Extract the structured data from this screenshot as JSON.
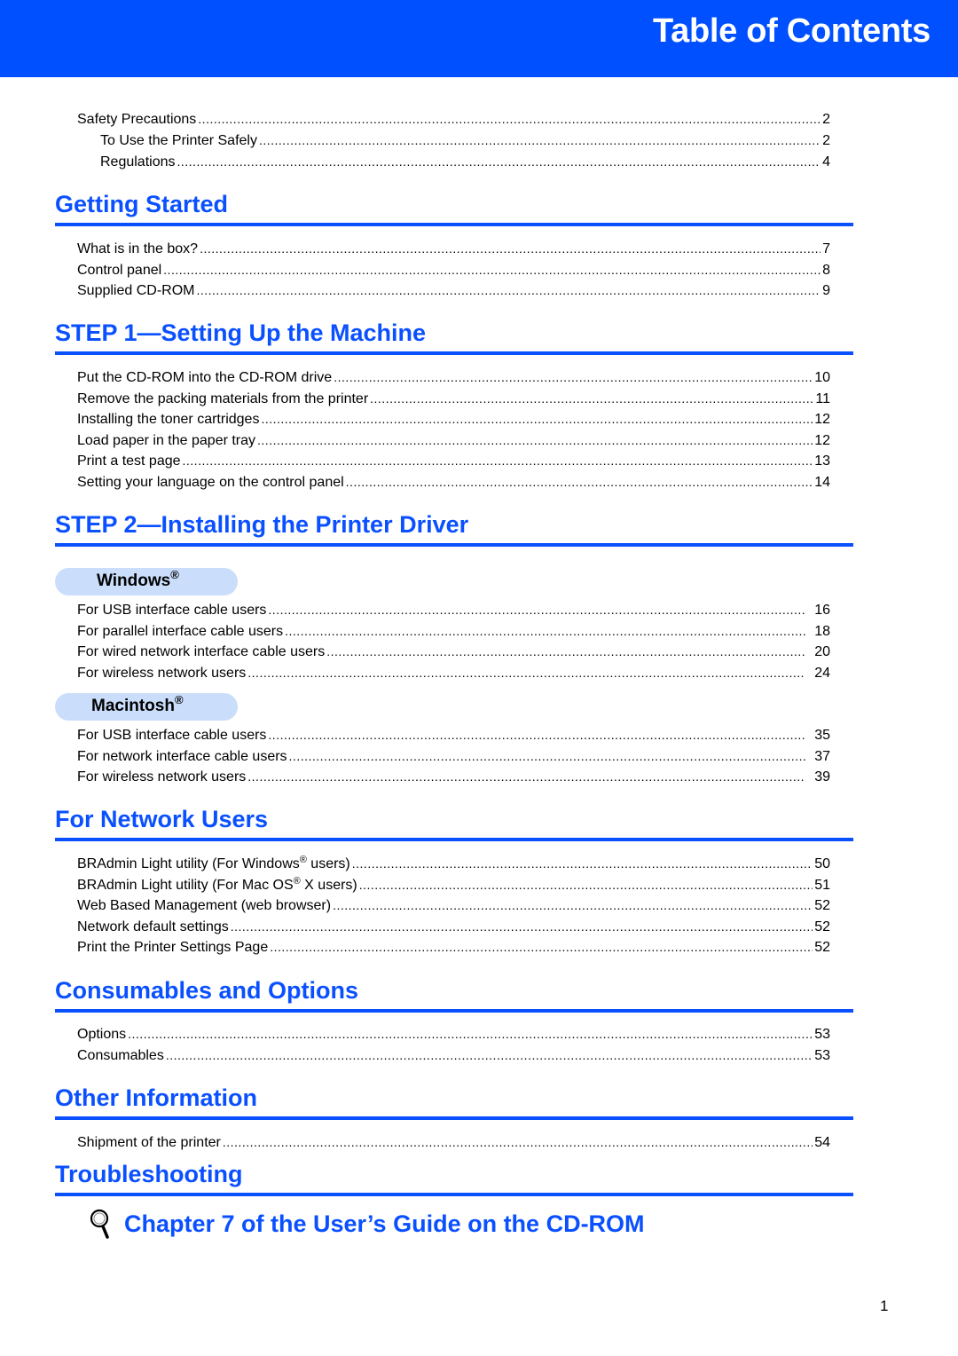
{
  "header": {
    "title": "Table of Contents",
    "bg_color": "#0050ff"
  },
  "accent_color": "#0a50ff",
  "intro": [
    {
      "label": "Safety Precautions",
      "page": "2"
    },
    {
      "label": "To Use the Printer Safely",
      "page": "2"
    },
    {
      "label": "Regulations",
      "page": "4"
    }
  ],
  "sections": {
    "getting_started": {
      "title": "Getting Started",
      "entries": [
        {
          "label": "What is in the box?",
          "page": "7"
        },
        {
          "label": "Control panel",
          "page": "8"
        },
        {
          "label": "Supplied CD-ROM",
          "page": "9"
        }
      ]
    },
    "step1": {
      "title": "STEP 1—Setting Up the Machine",
      "entries": [
        {
          "label": "Put the CD-ROM into the CD-ROM drive",
          "page": "10"
        },
        {
          "label": "Remove the packing materials from the printer",
          "page": "11"
        },
        {
          "label": "Installing the toner cartridges",
          "page": "12"
        },
        {
          "label": "Load paper in the paper tray",
          "page": "12"
        },
        {
          "label": "Print a test page",
          "page": "13"
        },
        {
          "label": "Setting your language on the control panel",
          "page": "14"
        }
      ]
    },
    "step2": {
      "title": "STEP 2—Installing the Printer Driver",
      "windows": {
        "label": "Windows",
        "reg": "®",
        "entries": [
          {
            "label": "For USB interface cable users",
            "page": "16"
          },
          {
            "label": "For parallel interface cable users",
            "page": "18"
          },
          {
            "label": "For wired network interface cable users",
            "page": "20"
          },
          {
            "label": "For wireless network users",
            "page": "24"
          }
        ]
      },
      "macintosh": {
        "label": "Macintosh",
        "reg": "®",
        "entries": [
          {
            "label": "For USB interface cable users",
            "page": "35"
          },
          {
            "label": "For network interface cable users",
            "page": "37"
          },
          {
            "label": "For wireless network users",
            "page": "39"
          }
        ]
      }
    },
    "network": {
      "title": "For Network Users",
      "entries": [
        {
          "label_pre": "BRAdmin Light utility (For Windows",
          "reg": "®",
          "label_post": " users)",
          "page": "50"
        },
        {
          "label_pre": "BRAdmin Light utility (For Mac OS",
          "reg": "®",
          "label_post": " X users)",
          "page": "51"
        },
        {
          "label": "Web Based Management (web browser)",
          "page": "52"
        },
        {
          "label": "Network default settings",
          "page": "52"
        },
        {
          "label": "Print the Printer Settings Page",
          "page": "52"
        }
      ]
    },
    "consumables": {
      "title": "Consumables and Options",
      "entries": [
        {
          "label": "Options",
          "page": "53"
        },
        {
          "label": "Consumables",
          "page": "53"
        }
      ]
    },
    "other": {
      "title": "Other Information",
      "entries": [
        {
          "label": "Shipment of the printer",
          "page": "54"
        }
      ]
    },
    "troubleshooting": {
      "title": "Troubleshooting",
      "reference": {
        "icon": "magnifier-icon",
        "text": "Chapter 7 of the User’s Guide on the CD-ROM"
      }
    }
  },
  "footer": {
    "page_number": "1"
  }
}
